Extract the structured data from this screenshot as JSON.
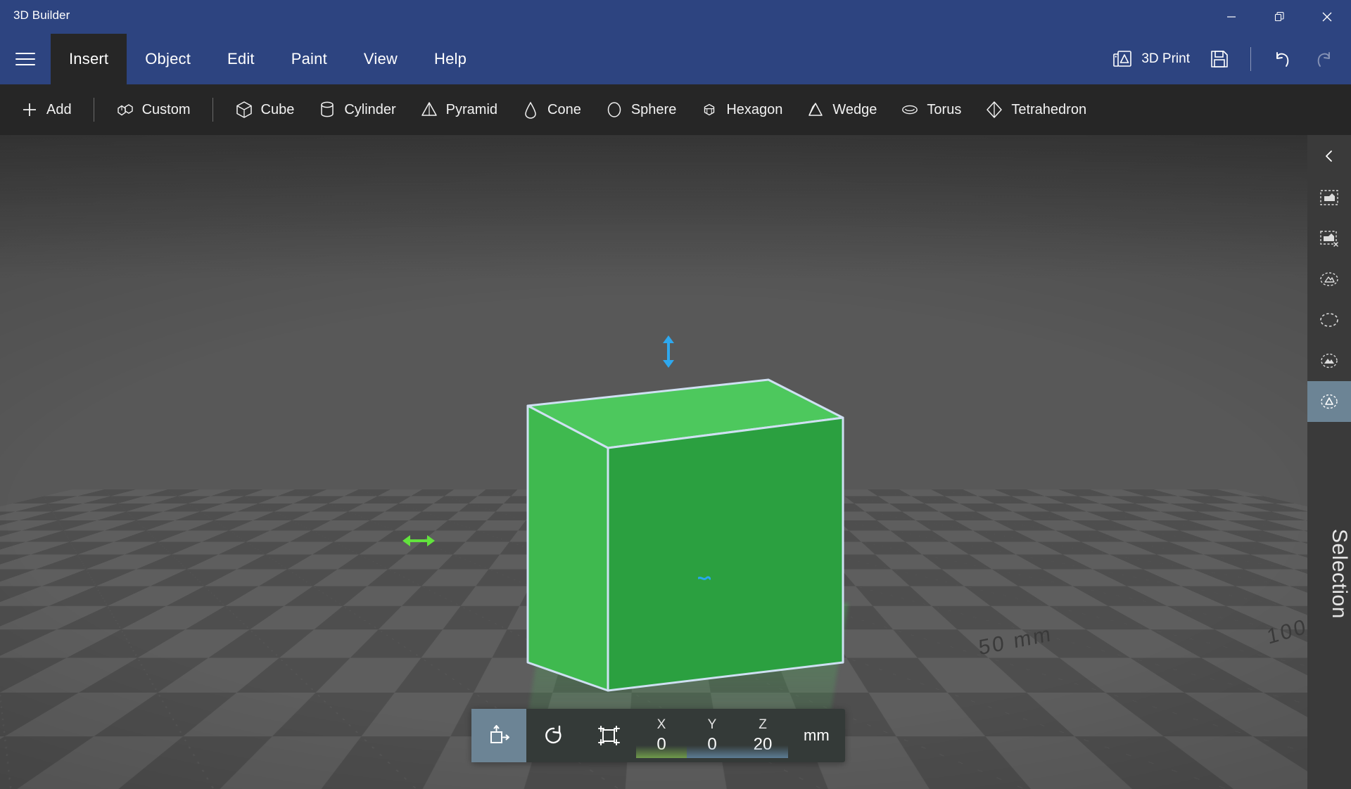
{
  "window": {
    "title": "3D Builder",
    "controls": [
      {
        "name": "minimize",
        "glyph": "─"
      },
      {
        "name": "maximize",
        "glyph": "❐"
      },
      {
        "name": "close",
        "glyph": "✕"
      }
    ]
  },
  "menubar": {
    "hamburger_label": "menu",
    "items": [
      {
        "label": "Insert",
        "active": true
      },
      {
        "label": "Object",
        "active": false
      },
      {
        "label": "Edit",
        "active": false
      },
      {
        "label": "Paint",
        "active": false
      },
      {
        "label": "View",
        "active": false
      },
      {
        "label": "Help",
        "active": false
      }
    ],
    "tools": [
      {
        "label": "3D Print",
        "icon": "printer-3d-icon",
        "disabled": false
      },
      {
        "label": "",
        "icon": "save-icon",
        "disabled": false
      },
      {
        "label": "",
        "icon": "undo-icon",
        "disabled": false
      },
      {
        "label": "",
        "icon": "redo-icon",
        "disabled": true
      }
    ]
  },
  "shapebar": {
    "add_label": "Add",
    "custom_label": "Custom",
    "shapes": [
      {
        "label": "Cube",
        "icon": "cube-icon"
      },
      {
        "label": "Cylinder",
        "icon": "cylinder-icon"
      },
      {
        "label": "Pyramid",
        "icon": "pyramid-icon"
      },
      {
        "label": "Cone",
        "icon": "cone-icon"
      },
      {
        "label": "Sphere",
        "icon": "sphere-icon"
      },
      {
        "label": "Hexagon",
        "icon": "hexagon-icon"
      },
      {
        "label": "Wedge",
        "icon": "wedge-icon"
      },
      {
        "label": "Torus",
        "icon": "torus-icon"
      },
      {
        "label": "Tetrahedron",
        "icon": "tetrahedron-icon"
      }
    ]
  },
  "viewport": {
    "grid_labels": [
      {
        "text": "50 mm"
      },
      {
        "text": "100"
      }
    ],
    "object": {
      "kind": "cube",
      "selected": true,
      "colors": {
        "top": "#4dc85d",
        "front": "#2ba040",
        "left": "#3fb94f",
        "outline": "#cfe0f2"
      }
    },
    "gizmos": [
      {
        "name": "height-handle",
        "color": "#2ea8ee",
        "direction": "vertical"
      },
      {
        "name": "width-handle",
        "color": "#62e33d",
        "direction": "horizontal"
      },
      {
        "name": "center-pivot",
        "color": "#2ea8ee"
      }
    ]
  },
  "transformbar": {
    "modes": [
      {
        "name": "move",
        "icon": "move-icon",
        "active": true
      },
      {
        "name": "rotate",
        "icon": "rotate-icon",
        "active": false
      },
      {
        "name": "scale",
        "icon": "scale-icon",
        "active": false
      }
    ],
    "fields": [
      {
        "axis": "X",
        "value": "0"
      },
      {
        "axis": "Y",
        "value": "0"
      },
      {
        "axis": "Z",
        "value": "20"
      }
    ],
    "unit": "mm"
  },
  "sidebar": {
    "collapse_icon": "chevron-left-icon",
    "panel_label": "Selection",
    "tools": [
      {
        "name": "select-all",
        "icon": "select-all-icon",
        "active": false
      },
      {
        "name": "deselect-all",
        "icon": "deselect-all-icon",
        "active": false
      },
      {
        "name": "select-similar",
        "icon": "select-similar-icon",
        "active": false
      },
      {
        "name": "select-none",
        "icon": "select-empty-icon",
        "active": false
      },
      {
        "name": "select-objects",
        "icon": "select-objects-icon",
        "active": false
      },
      {
        "name": "select-single",
        "icon": "select-single-icon",
        "active": true
      }
    ]
  },
  "colors": {
    "accent": "#2d4480",
    "toolbar_bg": "#262626",
    "sidebar_active": "#6c8495",
    "object_green": "#2ba040"
  }
}
